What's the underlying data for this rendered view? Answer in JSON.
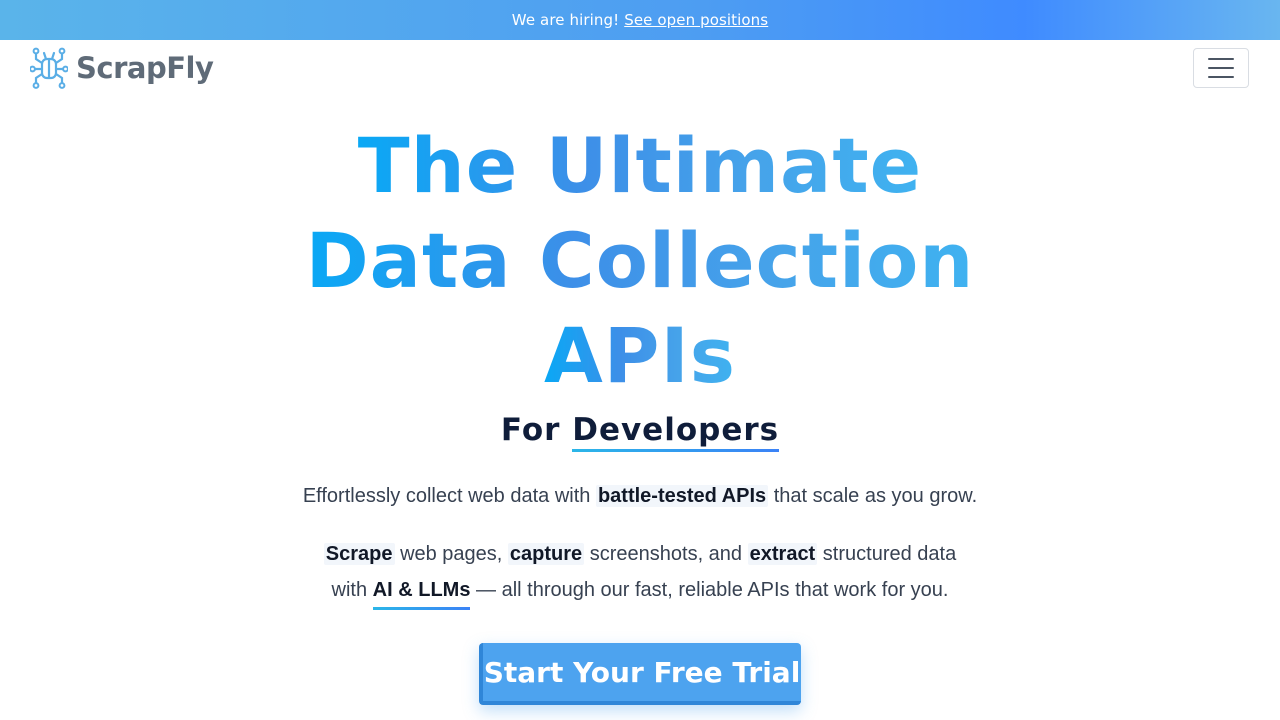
{
  "banner": {
    "text": "We are hiring!",
    "link_label": "See open positions"
  },
  "header": {
    "logo_text": "ScrapFly",
    "logo_icon": "spider-icon",
    "menu_icon": "hamburger-menu-icon"
  },
  "hero": {
    "title_lines": [
      "The Ultimate",
      "Data Collection",
      "APIs"
    ],
    "subtitle_prefix": "For",
    "subtitle_highlight": "Developers",
    "tagline": {
      "before": "Effortlessly collect web data with",
      "highlight": "battle-tested APIs",
      "after": "that scale as you grow."
    },
    "description": {
      "k1": "Scrape",
      "t1": "web pages,",
      "k2": "capture",
      "t2": "screenshots, and",
      "k3": "extract",
      "t3": "structured data",
      "t4": "with",
      "k4": "AI & LLMs",
      "t5": "— all through our fast, reliable APIs that work for you."
    },
    "cta_label": "Start Your Free Trial"
  },
  "colors": {
    "accent": "#4da3ef",
    "banner_start": "#5ab4ea",
    "banner_end": "#3f8bff",
    "title_gradient_start": "#0aa8f5",
    "heading_dark": "#0f1d3a"
  }
}
